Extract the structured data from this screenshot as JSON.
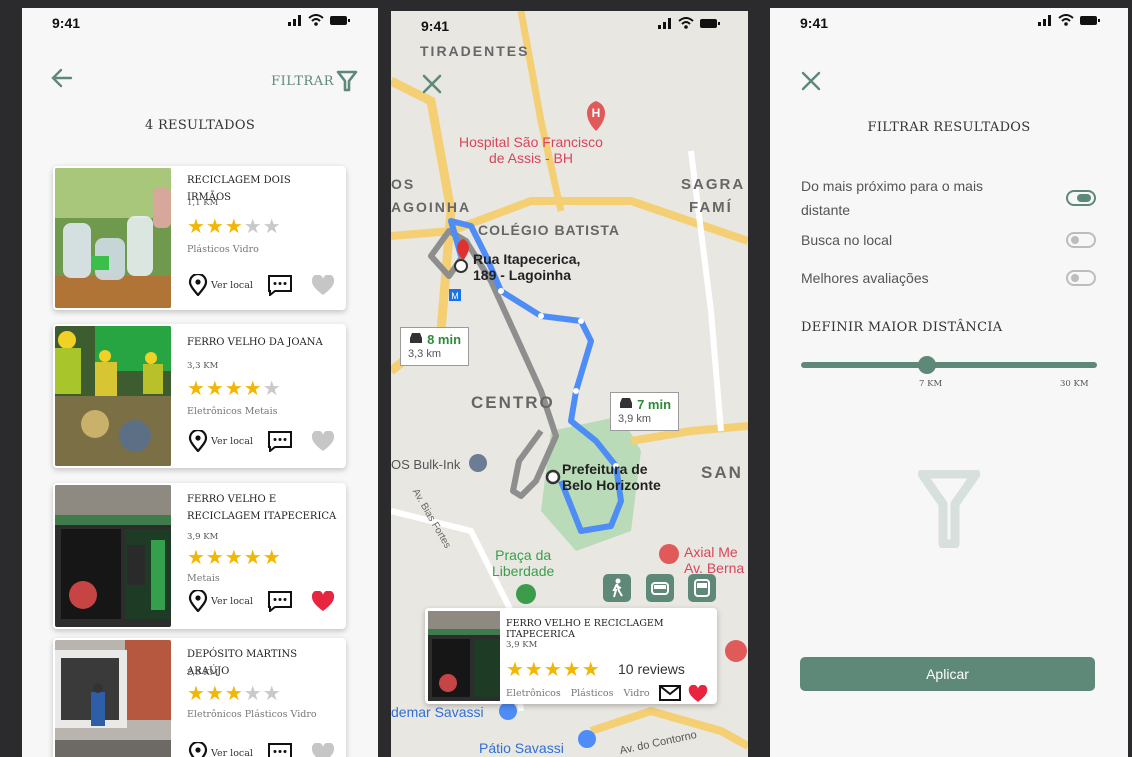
{
  "status": {
    "time": "9:41"
  },
  "list": {
    "filter_label": "FILTRAR",
    "results_count": "4 RESULTADOS",
    "ver_local": "Ver local",
    "items": [
      {
        "name": "RECICLAGEM DOIS IRMÃOS",
        "distance": "1,1 KM",
        "rating": 3,
        "categories": "Plásticos  Vidro",
        "favorite": false
      },
      {
        "name": "FERRO VELHO DA JOANA",
        "distance": "3,3 KM",
        "rating": 4,
        "categories": "Eletrônicos  Metais",
        "favorite": false
      },
      {
        "name": "FERRO VELHO E RECICLAGEM ITAPECERICA",
        "distance": "3,9 KM",
        "rating": 5,
        "categories": "Metais",
        "favorite": true
      },
      {
        "name": "DEPÓSITO MARTINS ARAÚJO",
        "distance": "2,5 KM",
        "rating": 3,
        "categories": "Eletrônicos  Plásticos  Vidro",
        "favorite": false
      }
    ]
  },
  "map": {
    "labels": {
      "tiradentes": "TIRADENTES",
      "hospital": "Hospital São Francisco\nde Assis - BH",
      "sagrada_1": "SAGRA",
      "sagrada_2": "FAMÍ",
      "os": "OS",
      "agoinha": "AGOINHA",
      "colegio": "COLÉGIO BATISTA",
      "origin": "Rua Itapecerica,\n189 - Lagoinha",
      "centro": "CENTRO",
      "san": "SAN",
      "bulkink": "OS Bulk-Ink",
      "prefeitura": "Prefeitura de\nBelo Horizonte",
      "bias_fortes": "Av. Bias Fortes",
      "praca": "Praça da\nLiberdade",
      "axial": "Axial Me\nAv. Berna",
      "savassi": "demar Savassi",
      "patio": "Pátio Savassi",
      "contorno": "Av. do Contorno"
    },
    "eta_alt": {
      "time": "8 min",
      "distance": "3,3 km"
    },
    "eta_main": {
      "time": "7 min",
      "distance": "3,9 km"
    },
    "selected": {
      "name": "FERRO VELHO E RECICLAGEM ITAPECERICA",
      "distance": "3,9 KM",
      "rating": 5,
      "reviews": "10 reviews",
      "categories": [
        "Eletrônicos",
        "Plásticos",
        "Vidro"
      ]
    }
  },
  "filter": {
    "title": "FILTRAR RESULTADOS",
    "options": [
      {
        "label": "Do mais próximo para o mais distante",
        "enabled": true
      },
      {
        "label": "Busca no local",
        "enabled": false
      },
      {
        "label": "Melhores avaliações",
        "enabled": false
      }
    ],
    "distance_title": "DEFINIR MAIOR DISTÂNCIA",
    "distance_value": "7 KM",
    "distance_max": "30 KM",
    "apply_label": "Aplicar"
  },
  "colors": {
    "accent": "#5e8878",
    "star": "#f2b705",
    "heart": "#e8243f"
  }
}
